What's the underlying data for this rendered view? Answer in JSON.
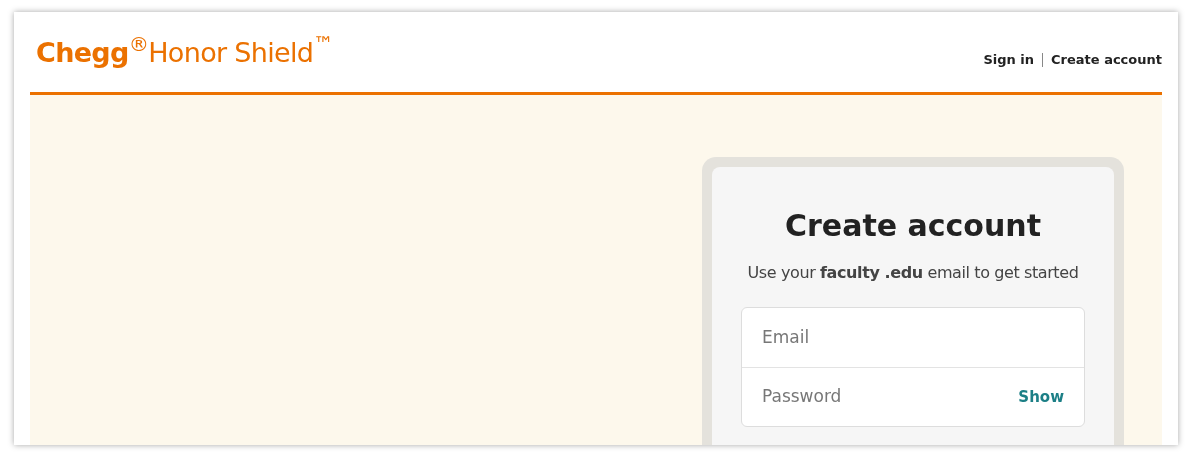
{
  "header": {
    "logo": "**Chegg**$^{®}$Honor Shield$^{™}$",
    "links": [
      {
        "label": "Sign in"
      },
      {
        "label": "Create account"
      }
    ]
  },
  "card": {
    "title": "Create account",
    "subtitle": "Use your **faculty .edu** email to get started",
    "fields": [
      {
        "placeholder": "Email"
      },
      {
        "placeholder": "Password",
        "action": "Show"
      }
    ]
  }
}
